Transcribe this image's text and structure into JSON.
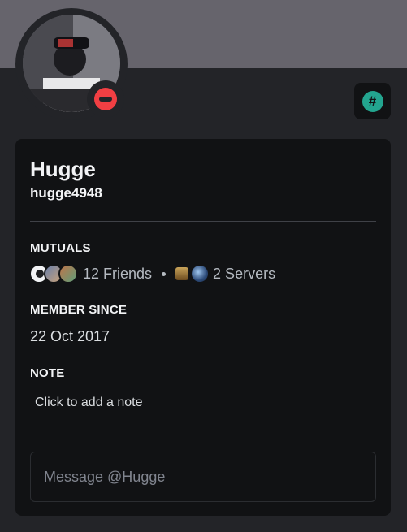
{
  "profile": {
    "display_name": "Hugge",
    "username": "hugge4948",
    "status": "do-not-disturb",
    "badge_icon": "hashtag-badge-icon",
    "badge_symbol": "#"
  },
  "mutuals": {
    "title": "MUTUALS",
    "friends_label": "12 Friends",
    "servers_label": "2 Servers"
  },
  "member_since": {
    "title": "MEMBER SINCE",
    "date": "22 Oct 2017"
  },
  "note": {
    "title": "NOTE",
    "placeholder": "Click to add a note"
  },
  "message": {
    "placeholder": "Message @Hugge"
  },
  "colors": {
    "banner": "#66646c",
    "background": "#232428",
    "card": "#111214",
    "status_dnd": "#f23f43",
    "badge_accent": "#23a58f"
  }
}
